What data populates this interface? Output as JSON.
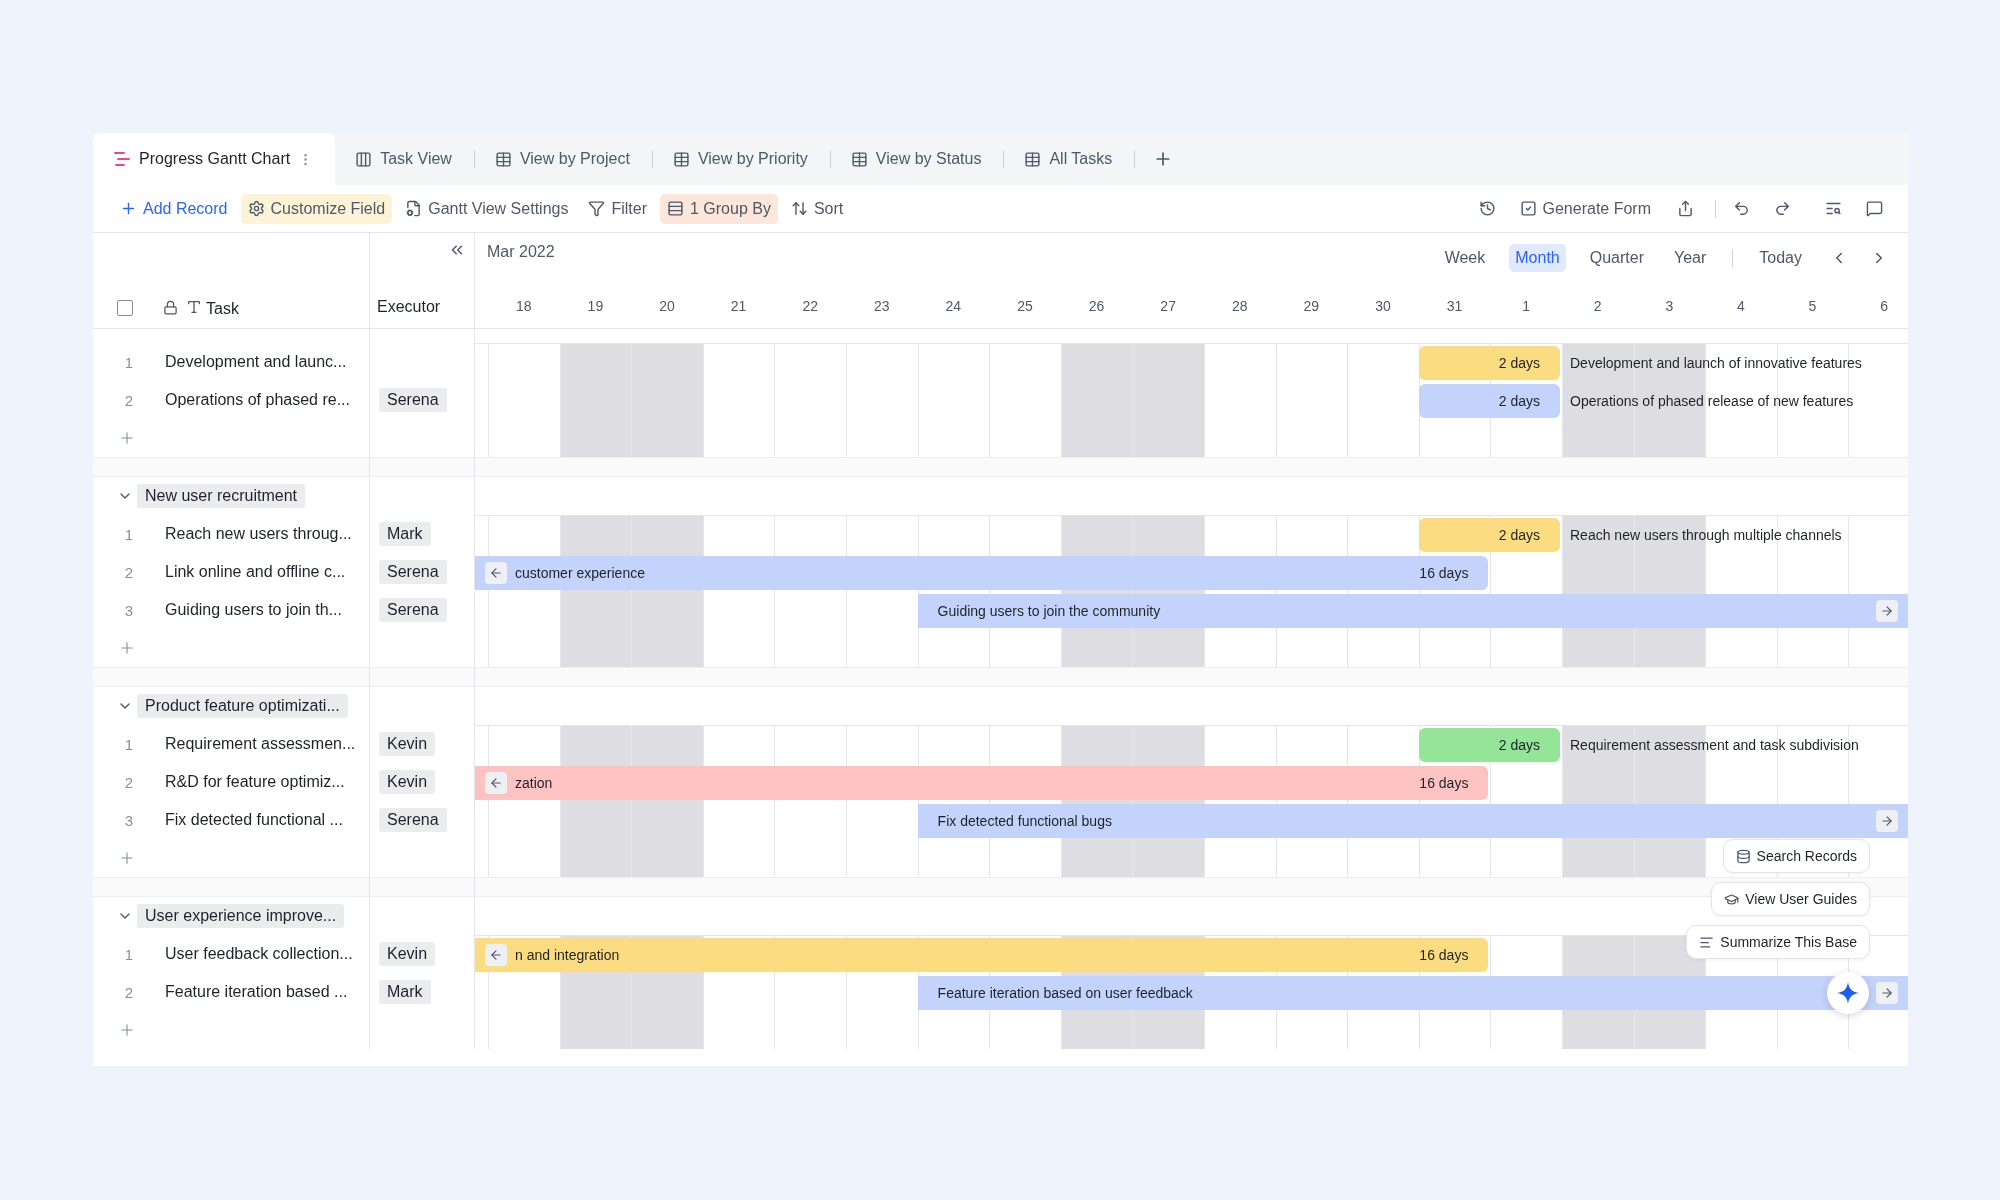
{
  "tabs": [
    {
      "label": "Progress Gantt Chart",
      "selected": true,
      "kind": "gantt"
    },
    {
      "label": "Task View",
      "selected": false,
      "kind": "kanban"
    },
    {
      "label": "View by Project",
      "selected": false,
      "kind": "grid"
    },
    {
      "label": "View by Priority",
      "selected": false,
      "kind": "grid"
    },
    {
      "label": "View by Status",
      "selected": false,
      "kind": "grid"
    },
    {
      "label": "All Tasks",
      "selected": false,
      "kind": "grid"
    }
  ],
  "toolbar": {
    "left": [
      {
        "label": "Add Record",
        "kind": "add"
      },
      {
        "label": "Customize Field",
        "kind": "field",
        "color": "#fdf3d6"
      },
      {
        "label": "Gantt View Settings",
        "kind": "settings"
      },
      {
        "label": "Filter",
        "kind": "filter"
      },
      {
        "label": "1 Group By",
        "kind": "group",
        "color": "#fde6da"
      },
      {
        "label": "Sort",
        "kind": "sort"
      }
    ],
    "right": [
      {
        "kind": "history"
      },
      {
        "kind": "form",
        "label": "Generate Form"
      },
      {
        "kind": "share"
      },
      {
        "kind": "undo"
      },
      {
        "kind": "redo"
      },
      {
        "kind": "search"
      },
      {
        "kind": "comment"
      }
    ]
  },
  "columns": {
    "task": "Task",
    "executor": "Executor",
    "select_all": {
      "checked": false
    }
  },
  "timeline": {
    "month": "Mar 2022",
    "today": "Today",
    "scales": [
      {
        "label": "Week",
        "selected": false
      },
      {
        "label": "Month",
        "selected": true
      },
      {
        "label": "Quarter",
        "selected": false
      },
      {
        "label": "Year",
        "selected": false
      }
    ],
    "days": [
      {
        "label": "18",
        "weekend": false
      },
      {
        "label": "19",
        "weekend": true
      },
      {
        "label": "20",
        "weekend": true
      },
      {
        "label": "21",
        "weekend": false
      },
      {
        "label": "22",
        "weekend": false
      },
      {
        "label": "23",
        "weekend": false
      },
      {
        "label": "24",
        "weekend": false
      },
      {
        "label": "25",
        "weekend": false
      },
      {
        "label": "26",
        "weekend": true
      },
      {
        "label": "27",
        "weekend": true
      },
      {
        "label": "28",
        "weekend": false
      },
      {
        "label": "29",
        "weekend": false
      },
      {
        "label": "30",
        "weekend": false
      },
      {
        "label": "31",
        "weekend": false
      },
      {
        "label": "1",
        "weekend": false
      },
      {
        "label": "2",
        "weekend": true
      },
      {
        "label": "3",
        "weekend": true
      },
      {
        "label": "4",
        "weekend": false
      },
      {
        "label": "5",
        "weekend": false
      },
      {
        "label": "6",
        "weekend": false
      }
    ]
  },
  "groups": [
    {
      "tasks": [
        {
          "number": "1",
          "task": "Development and launc...",
          "bar": {
            "kind": "short",
            "color": "#fbdc80",
            "duration": "2 days",
            "title": "Development and launch of innovative features"
          }
        },
        {
          "number": "2",
          "task": "Operations of phased re...",
          "executor": "Serena",
          "bar": {
            "kind": "short",
            "color": "#c3d3fb",
            "duration": "2 days",
            "title": "Operations of phased release of new features"
          }
        }
      ]
    },
    {
      "name": "New user recruitment",
      "expanded": true,
      "tasks": [
        {
          "number": "1",
          "task": "Reach new users throug...",
          "executor": "Mark",
          "bar": {
            "kind": "short",
            "color": "#fbdc80",
            "duration": "2 days",
            "title": "Reach new users through multiple channels"
          }
        },
        {
          "number": "2",
          "task": "Link online and offline c...",
          "executor": "Serena",
          "bar": {
            "kind": "left",
            "color": "#c3d3fb",
            "duration": "16 days",
            "label": "customer experience"
          }
        },
        {
          "number": "3",
          "task": "Guiding users to join th...",
          "executor": "Serena",
          "bar": {
            "kind": "right",
            "color": "#c3d3fb",
            "label": "Guiding users to join the community"
          }
        }
      ]
    },
    {
      "name": "Product feature optimizati...",
      "expanded": true,
      "tasks": [
        {
          "number": "1",
          "task": "Requirement assessmen...",
          "executor": "Kevin",
          "bar": {
            "kind": "short",
            "color": "#95e598",
            "duration": "2 days",
            "title": "Requirement assessment and task subdivision"
          }
        },
        {
          "number": "2",
          "task": "R&D for feature optimiz...",
          "executor": "Kevin",
          "bar": {
            "kind": "left",
            "color": "#fdc3c3",
            "duration": "16 days",
            "label": "zation"
          }
        },
        {
          "number": "3",
          "task": "Fix detected functional ...",
          "executor": "Serena",
          "bar": {
            "kind": "right",
            "color": "#c3d3fb",
            "label": "Fix detected functional bugs"
          }
        }
      ]
    },
    {
      "name": "User experience improve...",
      "expanded": true,
      "tasks": [
        {
          "number": "1",
          "task": "User feedback collection...",
          "executor": "Kevin",
          "bar": {
            "kind": "left",
            "color": "#fbdc80",
            "duration": "16 days",
            "label": "n and integration"
          }
        },
        {
          "number": "2",
          "task": "Feature iteration based ...",
          "executor": "Mark",
          "bar": {
            "kind": "right",
            "color": "#c3d3fb",
            "label": "Feature iteration based on user feedback"
          }
        }
      ]
    }
  ],
  "assistant": {
    "actions": [
      {
        "label": "Search Records",
        "kind": "records"
      },
      {
        "label": "View User Guides",
        "kind": "guides"
      },
      {
        "label": "Summarize This Base",
        "kind": "summary"
      }
    ]
  }
}
